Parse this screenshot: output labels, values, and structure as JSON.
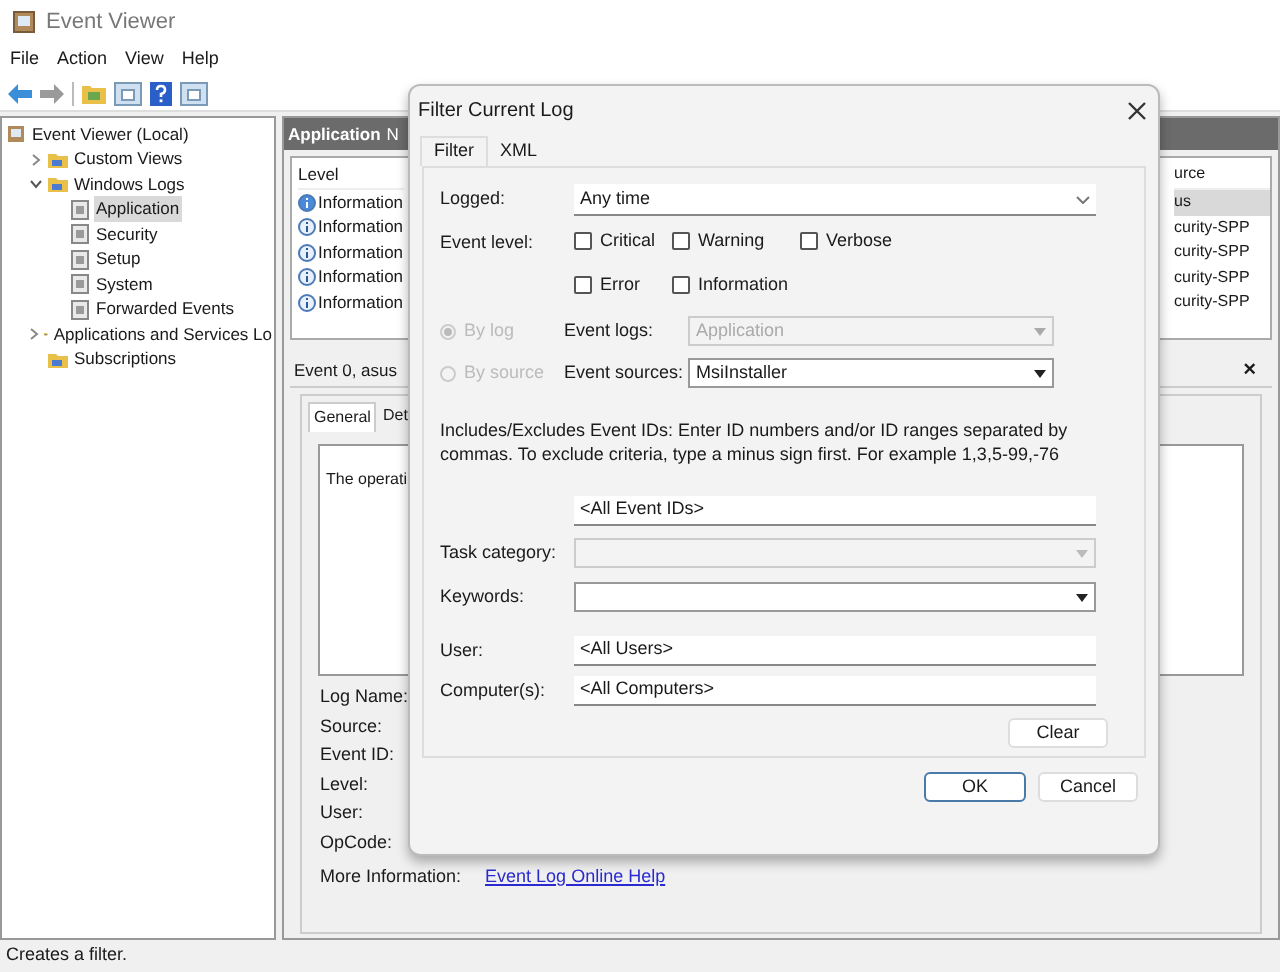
{
  "window": {
    "title": "Event Viewer"
  },
  "menu": [
    "File",
    "Action",
    "View",
    "Help"
  ],
  "tree": [
    {
      "label": "Event Viewer (Local)",
      "selected": false,
      "children": [
        {
          "label": "Custom Views",
          "expanded": false,
          "selected": false
        },
        {
          "label": "Windows Logs",
          "expanded": true,
          "selected": false,
          "children": [
            {
              "label": "Application",
              "selected": true
            },
            {
              "label": "Security",
              "selected": false
            },
            {
              "label": "Setup",
              "selected": false
            },
            {
              "label": "System",
              "selected": false
            },
            {
              "label": "Forwarded Events",
              "selected": false
            }
          ]
        },
        {
          "label": "Applications and Services Lo",
          "expanded": false,
          "selected": false
        },
        {
          "label": "Subscriptions",
          "selected": false
        }
      ]
    }
  ],
  "log_pane": {
    "title": "Application",
    "title_cut": "N",
    "columns": [
      "Level",
      "urce"
    ],
    "rows": [
      {
        "level": "Information",
        "source": "us",
        "selected": true
      },
      {
        "level": "Information",
        "source": "curity-SPP",
        "selected": false
      },
      {
        "level": "Information",
        "source": "curity-SPP",
        "selected": false
      },
      {
        "level": "Information",
        "source": "curity-SPP",
        "selected": false
      },
      {
        "level": "Information",
        "source": "curity-SPP",
        "selected": false
      }
    ]
  },
  "event_pane": {
    "title": "Event 0, asus",
    "close": "×",
    "tabs": [
      {
        "label": "General",
        "selected": true
      },
      {
        "label": "Det",
        "selected": false
      }
    ],
    "description": "The operati",
    "fields": [
      "Log Name:",
      "Source:",
      "Event ID:",
      "Level:",
      "User:",
      "OpCode:"
    ],
    "more_info_label": "More Information:",
    "more_info_link": "Event Log Online Help"
  },
  "dialog": {
    "title": "Filter Current Log",
    "tabs": [
      {
        "label": "Filter",
        "selected": true
      },
      {
        "label": "XML",
        "selected": false
      }
    ],
    "logged": {
      "label": "Logged:",
      "value": "Any time"
    },
    "event_level": {
      "label": "Event level:",
      "options": [
        {
          "label": "Critical",
          "checked": false
        },
        {
          "label": "Warning",
          "checked": false
        },
        {
          "label": "Verbose",
          "checked": false
        },
        {
          "label": "Error",
          "checked": false
        },
        {
          "label": "Information",
          "checked": false
        }
      ]
    },
    "sources": [
      {
        "radio": "By log",
        "selected": true,
        "disabled": true,
        "label": "Event logs:",
        "value": "Application",
        "field_disabled": true
      },
      {
        "radio": "By source",
        "selected": false,
        "disabled": true,
        "label": "Event sources:",
        "value": "MsiInstaller",
        "field_disabled": false
      }
    ],
    "ids_hint": "Includes/Excludes Event IDs: Enter ID numbers and/or ID ranges separated by commas. To exclude criteria, type a minus sign first. For example 1,3,5-99,-76",
    "ids_value": "<All Event IDs>",
    "task_category": {
      "label": "Task category:",
      "disabled": true
    },
    "keywords": {
      "label": "Keywords:",
      "disabled": false
    },
    "user": {
      "label": "User:",
      "value": "<All Users>"
    },
    "computer": {
      "label": "Computer(s):",
      "value": "<All Computers>"
    },
    "clear": "Clear",
    "ok": "OK",
    "cancel": "Cancel"
  },
  "status_bar": "Creates a filter."
}
